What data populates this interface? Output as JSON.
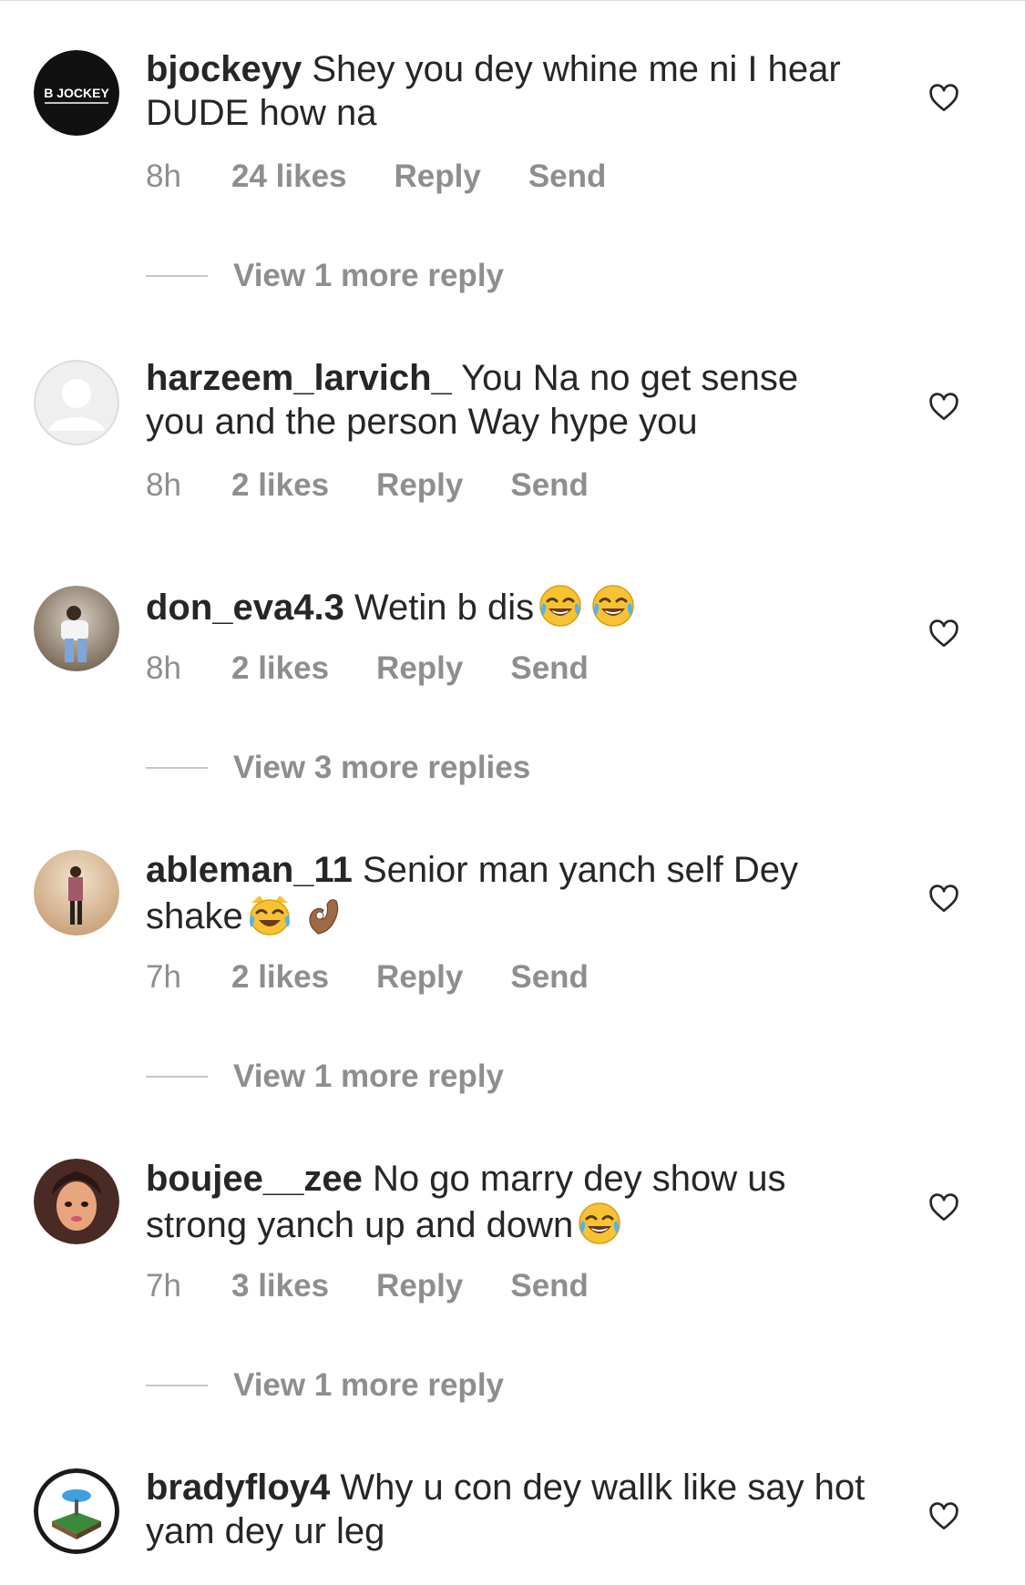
{
  "comments": [
    {
      "username": "bjockeyy",
      "text": "Shey you dey whine me ni I hear DUDE how na",
      "time": "8h",
      "likes": "24 likes",
      "reply": "Reply",
      "send": "Send",
      "view_replies": "View 1 more reply",
      "avatar_text": "B JOCKEY"
    },
    {
      "username": "harzeem_larvich_",
      "text": "You Na no get sense you and the person Way hype you",
      "time": "8h",
      "likes": "2 likes",
      "reply": "Reply",
      "send": "Send"
    },
    {
      "username": "don_eva4.3",
      "text": "Wetin b dis",
      "emojis": [
        "face-with-tears-of-joy",
        "face-with-tears-of-joy"
      ],
      "time": "8h",
      "likes": "2 likes",
      "reply": "Reply",
      "send": "Send",
      "view_replies": "View 3 more replies"
    },
    {
      "username": "ableman_11",
      "text": "Senior man yanch self Dey shake",
      "emojis": [
        "cat-with-tears-of-joy",
        "ok-hand"
      ],
      "time": "7h",
      "likes": "2 likes",
      "reply": "Reply",
      "send": "Send",
      "view_replies": "View 1 more reply"
    },
    {
      "username": "boujee__zee",
      "text": "No go marry dey show us strong yanch up and down",
      "emojis": [
        "face-with-tears-of-joy"
      ],
      "time": "7h",
      "likes": "3 likes",
      "reply": "Reply",
      "send": "Send",
      "view_replies": "View 1 more reply"
    },
    {
      "username": "bradyfloy4",
      "text": "Why u con dey wallk like say hot yam dey ur leg"
    }
  ],
  "icons": {
    "like": "heart-outline-icon"
  },
  "colors": {
    "text": "#262626",
    "secondary": "#8e8e8e",
    "divider": "#dbdbdb"
  }
}
